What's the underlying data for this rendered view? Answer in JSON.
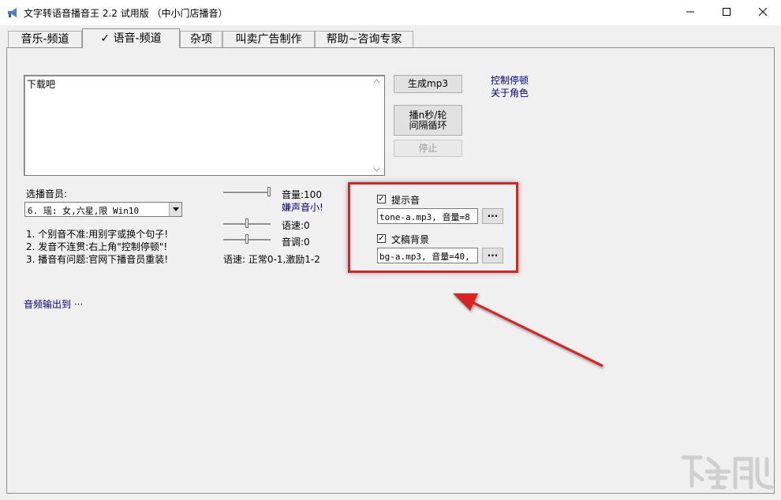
{
  "window": {
    "title": "文字转语音播音王 2.2 试用版 （中小门店播音）",
    "controls": {
      "minimize": "—",
      "maximize": "☐",
      "close": "✕"
    }
  },
  "tabs": [
    {
      "label": "音乐-频道"
    },
    {
      "label": "✓ 语音-频道"
    },
    {
      "label": "杂项"
    },
    {
      "label": "叫卖广告制作"
    },
    {
      "label": "帮助~咨询专家"
    }
  ],
  "editor": {
    "text": "下载吧"
  },
  "buttons": {
    "generate_mp3": "生成mp3",
    "loop_line1": "播n秒/轮",
    "loop_line2": "间隔循环",
    "stop": "停止"
  },
  "links": {
    "control_pause": "控制停顿",
    "about_role": "关于角色",
    "audio_output": "音频输出到 ···"
  },
  "voice": {
    "label": "选播音员:",
    "selected": "6. 瑶: 女,六星,限 Win10"
  },
  "tips": [
    "1. 个别音不准:用别字或换个句子!",
    "2. 发音不连贯:右上角\"控制停顿\"!",
    "3. 播音有问题:官网下播音员重装!"
  ],
  "sliders": {
    "volume_label": "音量:100",
    "volume_note": "嫌声音小!",
    "volume_value": 1.0,
    "speed_label": "语速:0",
    "speed_value": 0.5,
    "pitch_label": "音调:0",
    "pitch_value": 0.5,
    "speed_hint": "语速: 正常0-1,激励1-2"
  },
  "extras": {
    "tone_label": "提示音",
    "tone_checked": "✓",
    "tone_field": "tone-a.mp3, 音量=8",
    "bg_label": "文稿背景",
    "bg_checked": "✓",
    "bg_field": "bg-a.mp3, 音量=40,",
    "browse": "···"
  },
  "colors": {
    "highlight": "#d92323",
    "link": "#000080"
  }
}
